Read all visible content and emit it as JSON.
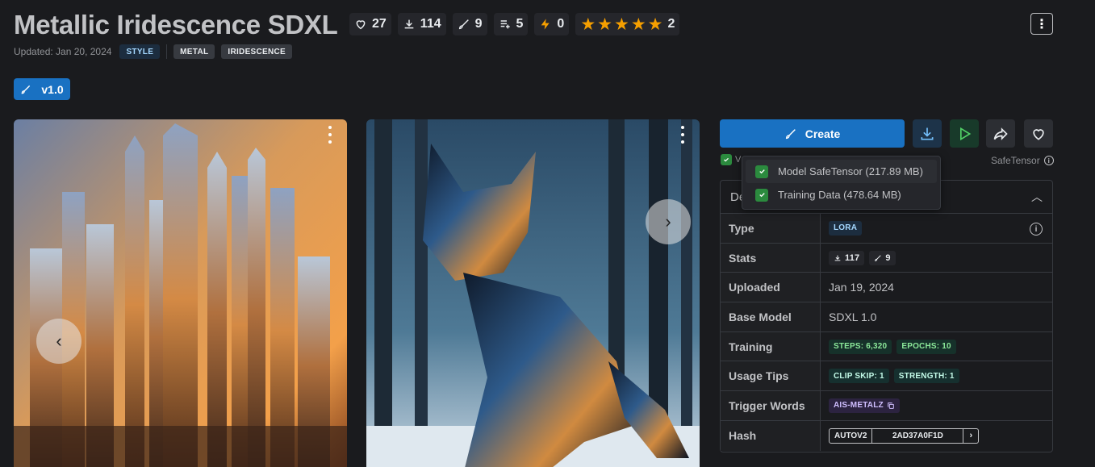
{
  "model": {
    "title": "Metallic Iridescence SDXL",
    "updated": "Updated: Jan 20, 2024",
    "tags": [
      "STYLE",
      "METAL",
      "IRIDESCENCE"
    ],
    "version": "v1.0"
  },
  "stats": {
    "likes": "27",
    "downloads": "114",
    "generations": "9",
    "collections": "5",
    "buzz": "0",
    "rating_stars": 5,
    "rating_count": "2"
  },
  "actions": {
    "create_label": "Create"
  },
  "verified_prefix": "V",
  "safetensor_label": "SafeTensor",
  "dropdown": {
    "items": [
      "Model SafeTensor (217.89 MB)",
      "Training Data (478.64 MB)"
    ]
  },
  "details": {
    "header": "De",
    "rows": {
      "type": {
        "label": "Type",
        "value": "LORA"
      },
      "stats": {
        "label": "Stats",
        "downloads": "117",
        "generations": "9"
      },
      "uploaded": {
        "label": "Uploaded",
        "value": "Jan 19, 2024"
      },
      "base_model": {
        "label": "Base Model",
        "value": "SDXL 1.0"
      },
      "training": {
        "label": "Training",
        "steps": "STEPS: 6,320",
        "epochs": "EPOCHS: 10"
      },
      "usage_tips": {
        "label": "Usage Tips",
        "clip_skip": "CLIP SKIP: 1",
        "strength": "STRENGTH: 1"
      },
      "trigger_words": {
        "label": "Trigger Words",
        "value": "AIS-METALZ"
      },
      "hash": {
        "label": "Hash",
        "type": "AUTOV2",
        "value": "2AD37A0F1D"
      }
    }
  },
  "colors": {
    "background": "#1a1b1e",
    "accent": "#1971c2",
    "star": "#f59f00",
    "verified": "#2b8a3e"
  }
}
